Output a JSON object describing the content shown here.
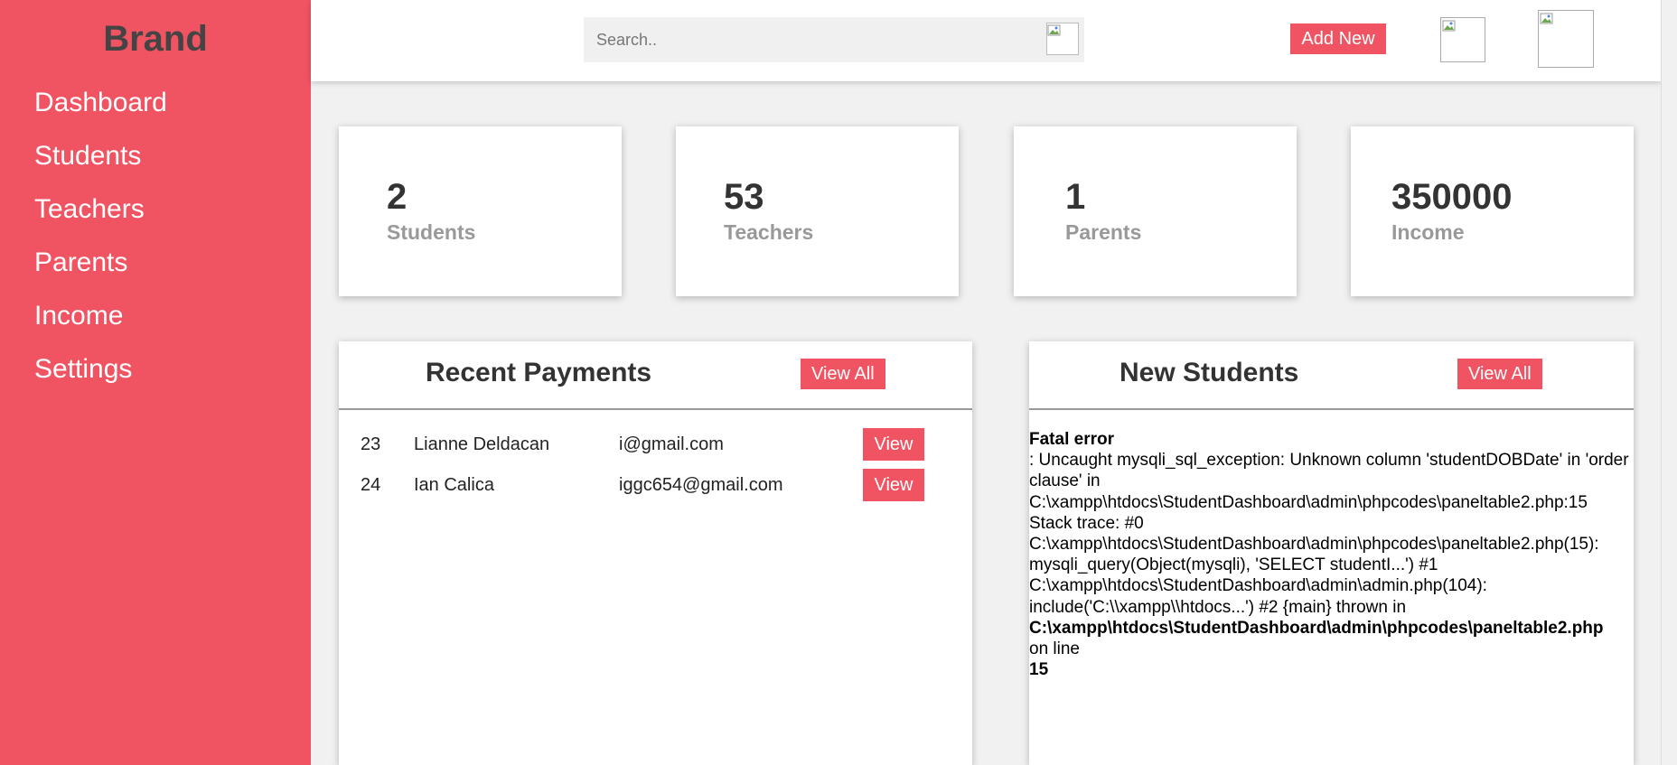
{
  "sidebar": {
    "brand": "Brand",
    "items": [
      "Dashboard",
      "Students",
      "Teachers",
      "Parents",
      "Income",
      "Settings"
    ]
  },
  "topbar": {
    "search_placeholder": "Search..",
    "search_value": "",
    "add_new_label": "Add New"
  },
  "cards": [
    {
      "number": "2",
      "label": "Students"
    },
    {
      "number": "53",
      "label": "Teachers"
    },
    {
      "number": "1",
      "label": "Parents"
    },
    {
      "number": "350000",
      "label": "Income"
    }
  ],
  "recent_payments": {
    "title": "Recent Payments",
    "view_all_label": "View All",
    "rows": [
      {
        "id": "23",
        "name": "Lianne Deldacan",
        "email": "i@gmail.com",
        "action": "View"
      },
      {
        "id": "24",
        "name": "Ian Calica",
        "email": "iggc654@gmail.com",
        "action": "View"
      }
    ]
  },
  "new_students": {
    "title": "New Students",
    "view_all_label": "View All",
    "error_title": "Fatal error",
    "error_message": ": Uncaught mysqli_sql_exception: Unknown column 'studentDOBDate' in 'order clause' in C:\\xampp\\htdocs\\StudentDashboard\\admin\\phpcodes\\paneltable2.php:15 Stack trace: #0 C:\\xampp\\htdocs\\StudentDashboard\\admin\\phpcodes\\paneltable2.php(15): mysqli_query(Object(mysqli), 'SELECT studentI...') #1 C:\\xampp\\htdocs\\StudentDashboard\\admin\\admin.php(104): include('C:\\\\xampp\\\\htdocs...') #2 {main} thrown in",
    "error_file": "C:\\xampp\\htdocs\\StudentDashboard\\admin\\phpcodes\\paneltable2.php",
    "error_online": "on line",
    "error_line": "15"
  },
  "colors": {
    "accent": "#f05462",
    "page_bg": "#f1f1f1",
    "brand_text": "#444444"
  }
}
